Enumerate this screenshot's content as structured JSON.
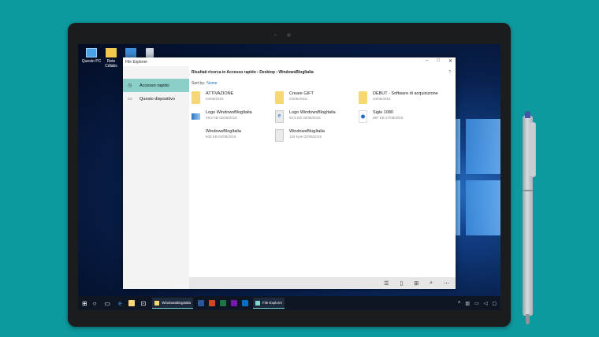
{
  "desktop": {
    "icons": [
      {
        "label": "Questo PC",
        "icon": "computer-icon"
      },
      {
        "label": "Rete",
        "label2": "Cdlabs",
        "icon": "folder-icon"
      },
      {
        "label": "",
        "icon": "network-icon"
      },
      {
        "label": "",
        "icon": "recycle-bin-icon"
      }
    ]
  },
  "explorer": {
    "title": "File Explorer",
    "window_controls": {
      "minimize": "–",
      "maximize": "□",
      "close": "✕"
    },
    "nav": [
      {
        "label": "Accesso rapido",
        "icon": "clock-icon",
        "active": true
      },
      {
        "label": "Questo dispositivo",
        "icon": "device-icon",
        "active": false
      }
    ],
    "breadcrumb": "Risultati ricerca in Accesso rapido  ›  Desktop  ›  WindowsBlogItalia",
    "help": "?",
    "sort_label": "Sort by:",
    "sort_value": "Nome",
    "files": [
      {
        "name": "ATTIVAZIONE",
        "meta": "04/08/2016",
        "type": "folder"
      },
      {
        "name": "Creare GIFT",
        "meta": "04/08/2016",
        "type": "folder"
      },
      {
        "name": "DEBUT - Software di acquisizione",
        "meta": "04/08/2016",
        "type": "folder"
      },
      {
        "name": "Logo WindowsBlogItalia",
        "meta": "49,8 KB 04/06/2015",
        "type": "image"
      },
      {
        "name": "Logo WindowsBlogItalia",
        "meta": "50,5 KB 02/06/2015",
        "type": "edge-doc"
      },
      {
        "name": "Sigle 1080",
        "meta": "687 KB 27/08/2015",
        "type": "image"
      },
      {
        "name": "WindowsBlogItalia",
        "meta": "505 KB 02/08/2015",
        "type": "blank"
      },
      {
        "name": "WindowsBlogItalia",
        "meta": "126 byte 02/06/2015",
        "type": "doc"
      }
    ],
    "commands": [
      "list-view-icon",
      "phone-icon",
      "grid-view-icon",
      "search-icon",
      "more-icon"
    ]
  },
  "taskbar": {
    "tasks": [
      {
        "label": "WindowsBlogItalia"
      },
      {
        "label": "File Explorer"
      }
    ],
    "colors": {
      "word": "#2b579a",
      "powerpoint": "#d24726",
      "excel": "#217346",
      "onenote": "#7719aa",
      "outlook": "#0072c6",
      "accent": "#7fd8d0"
    }
  }
}
